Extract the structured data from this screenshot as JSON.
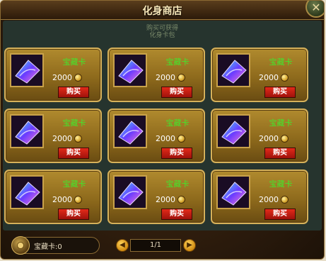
{
  "window": {
    "title": "化身商店",
    "close_glyph": "✕"
  },
  "panel": {
    "subtitle_line1": "购买可获得",
    "subtitle_line2": "化身卡包"
  },
  "items": [
    {
      "name": "宝藏卡",
      "price": "2000",
      "buy_label": "购买",
      "icon": "treasure-card-icon"
    },
    {
      "name": "宝藏卡",
      "price": "2000",
      "buy_label": "购买",
      "icon": "treasure-card-icon"
    },
    {
      "name": "宝藏卡",
      "price": "2000",
      "buy_label": "购买",
      "icon": "treasure-card-icon"
    },
    {
      "name": "宝藏卡",
      "price": "2000",
      "buy_label": "购买",
      "icon": "treasure-card-icon"
    },
    {
      "name": "宝藏卡",
      "price": "2000",
      "buy_label": "购买",
      "icon": "treasure-card-icon"
    },
    {
      "name": "宝藏卡",
      "price": "2000",
      "buy_label": "购买",
      "icon": "treasure-card-icon"
    },
    {
      "name": "宝藏卡",
      "price": "2000",
      "buy_label": "购买",
      "icon": "treasure-card-icon"
    },
    {
      "name": "宝藏卡",
      "price": "2000",
      "buy_label": "购买",
      "icon": "treasure-card-icon"
    },
    {
      "name": "宝藏卡",
      "price": "2000",
      "buy_label": "购买",
      "icon": "treasure-card-icon"
    }
  ],
  "footer": {
    "wallet_label": "宝藏卡:0",
    "page_indicator": "1/1",
    "prev_glyph": "◀",
    "next_glyph": "▶"
  },
  "colors": {
    "item_name": "#42e62c",
    "buy_button": "#d01e12",
    "card_gold": "#b08a2e"
  }
}
